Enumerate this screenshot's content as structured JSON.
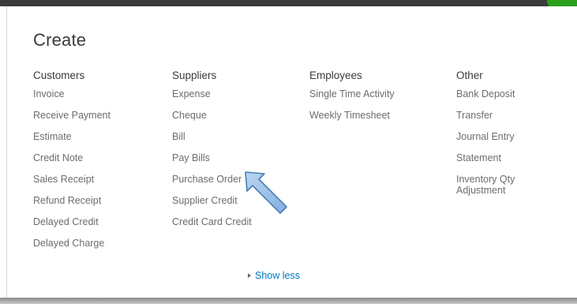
{
  "panel": {
    "title": "Create"
  },
  "columns": {
    "customers": {
      "heading": "Customers",
      "items": [
        "Invoice",
        "Receive Payment",
        "Estimate",
        "Credit Note",
        "Sales Receipt",
        "Refund Receipt",
        "Delayed Credit",
        "Delayed Charge"
      ]
    },
    "suppliers": {
      "heading": "Suppliers",
      "items": [
        "Expense",
        "Cheque",
        "Bill",
        "Pay Bills",
        "Purchase Order",
        "Supplier Credit",
        "Credit Card Credit"
      ]
    },
    "employees": {
      "heading": "Employees",
      "items": [
        "Single Time Activity",
        "Weekly Timesheet"
      ]
    },
    "other": {
      "heading": "Other",
      "items": [
        "Bank Deposit",
        "Transfer",
        "Journal Entry",
        "Statement",
        "Inventory Qty Adjustment"
      ]
    }
  },
  "footer": {
    "show_less_label": "Show less"
  },
  "annotation": {
    "icon": "pointer-arrow-icon",
    "color": "#9cc3e6",
    "outline": "#4a7fb5"
  }
}
